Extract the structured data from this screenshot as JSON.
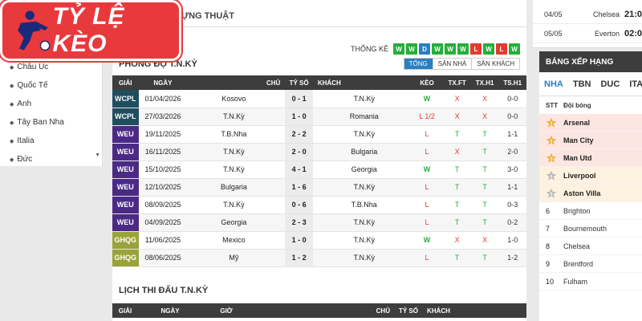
{
  "logo": {
    "text": "TỶ LỆ KÈO"
  },
  "sidebar": {
    "items": [
      {
        "label": "Châu Úc"
      },
      {
        "label": "Quốc Tế"
      },
      {
        "label": "Anh"
      },
      {
        "label": "Tây Ban Nha"
      },
      {
        "label": "Italia"
      },
      {
        "label": "Đức"
      }
    ]
  },
  "main": {
    "heading_fragment": "ỰNG THUẬT",
    "stats_label": "THỐNG KÊ",
    "recent_results": [
      "W",
      "W",
      "D",
      "W",
      "W",
      "W",
      "L",
      "W",
      "L",
      "W"
    ],
    "form_title": "PHONG ĐỘ T.N.KỲ",
    "filter_tabs": [
      "TỔNG",
      "SÂN NHÀ",
      "SÂN KHÁCH"
    ],
    "form_columns": [
      "GIẢI",
      "NGÀY",
      "CHỦ",
      "TỶ SỐ",
      "KHÁCH",
      "KÈO",
      "TX.FT",
      "TX.H1",
      "TS.H1"
    ],
    "form_rows": [
      {
        "league": "WCPL",
        "date": "01/04/2026",
        "home": "Kosovo",
        "score": "0 - 1",
        "away": "T.N.Kỳ",
        "keo": "W",
        "txft": "X",
        "txh1": "X",
        "tsh1": "0-0"
      },
      {
        "league": "WCPL",
        "date": "27/03/2026",
        "home": "T.N.Kỳ",
        "score": "1 - 0",
        "away": "Romania",
        "keo": "L 1/2",
        "txft": "X",
        "txh1": "X",
        "tsh1": "0-0"
      },
      {
        "league": "WEU",
        "date": "19/11/2025",
        "home": "T.B.Nha",
        "score": "2 - 2",
        "away": "T.N.Kỳ",
        "keo": "L",
        "txft": "T",
        "txh1": "T",
        "tsh1": "1-1"
      },
      {
        "league": "WEU",
        "date": "16/11/2025",
        "home": "T.N.Kỳ",
        "score": "2 - 0",
        "away": "Bulgaria",
        "keo": "L",
        "txft": "X",
        "txh1": "T",
        "tsh1": "2-0"
      },
      {
        "league": "WEU",
        "date": "15/10/2025",
        "home": "T.N.Kỳ",
        "score": "4 - 1",
        "away": "Georgia",
        "keo": "W",
        "txft": "T",
        "txh1": "T",
        "tsh1": "3-0"
      },
      {
        "league": "WEU",
        "date": "12/10/2025",
        "home": "Bulgaria",
        "score": "1 - 6",
        "away": "T.N.Kỳ",
        "keo": "L",
        "txft": "T",
        "txh1": "T",
        "tsh1": "1-1"
      },
      {
        "league": "WEU",
        "date": "08/09/2025",
        "home": "T.N.Kỳ",
        "score": "0 - 6",
        "away": "T.B.Nha",
        "keo": "L",
        "txft": "T",
        "txh1": "T",
        "tsh1": "0-3"
      },
      {
        "league": "WEU",
        "date": "04/09/2025",
        "home": "Georgia",
        "score": "2 - 3",
        "away": "T.N.Kỳ",
        "keo": "L",
        "txft": "T",
        "txh1": "T",
        "tsh1": "0-2"
      },
      {
        "league": "GHQG",
        "date": "11/06/2025",
        "home": "Mexico",
        "score": "1 - 0",
        "away": "T.N.Kỳ",
        "keo": "W",
        "txft": "X",
        "txh1": "X",
        "tsh1": "1-0"
      },
      {
        "league": "GHQG",
        "date": "08/06/2025",
        "home": "Mỹ",
        "score": "1 - 2",
        "away": "T.N.Kỳ",
        "keo": "L",
        "txft": "T",
        "txh1": "T",
        "tsh1": "1-2"
      }
    ],
    "league_colors": {
      "WCPL": "#1f4e5f",
      "WEU": "#4b2a86",
      "GHQG": "#9aa33a"
    },
    "fixtures_title": "LỊCH THI ĐẤU T.N.KỲ",
    "fixtures_columns": [
      "GIẢI",
      "NGÀY",
      "GIỜ",
      "CHỦ",
      "TỶ SỐ",
      "KHÁCH"
    ]
  },
  "upcoming": [
    {
      "date": "04/05",
      "team": "Chelsea",
      "time": "21:0"
    },
    {
      "date": "05/05",
      "team": "Everton",
      "time": "02:0"
    }
  ],
  "standings": {
    "title": "BẢNG XẾP HẠNG",
    "tabs": [
      "NHA",
      "TBN",
      "DUC",
      "ITA"
    ],
    "col_pos": "STT",
    "col_team": "Đội bóng",
    "rows": [
      {
        "pos": "1",
        "team": "Arsenal",
        "badge": "gold"
      },
      {
        "pos": "2",
        "team": "Man City",
        "badge": "gold"
      },
      {
        "pos": "3",
        "team": "Man Utd",
        "badge": "gold"
      },
      {
        "pos": "4",
        "team": "Liverpool",
        "badge": "silver"
      },
      {
        "pos": "5",
        "team": "Aston Villa",
        "badge": "silver"
      },
      {
        "pos": "6",
        "team": "Brighton",
        "badge": ""
      },
      {
        "pos": "7",
        "team": "Bournemouth",
        "badge": ""
      },
      {
        "pos": "8",
        "team": "Chelsea",
        "badge": ""
      },
      {
        "pos": "9",
        "team": "Brentford",
        "badge": ""
      },
      {
        "pos": "10",
        "team": "Fulham",
        "badge": ""
      }
    ]
  }
}
